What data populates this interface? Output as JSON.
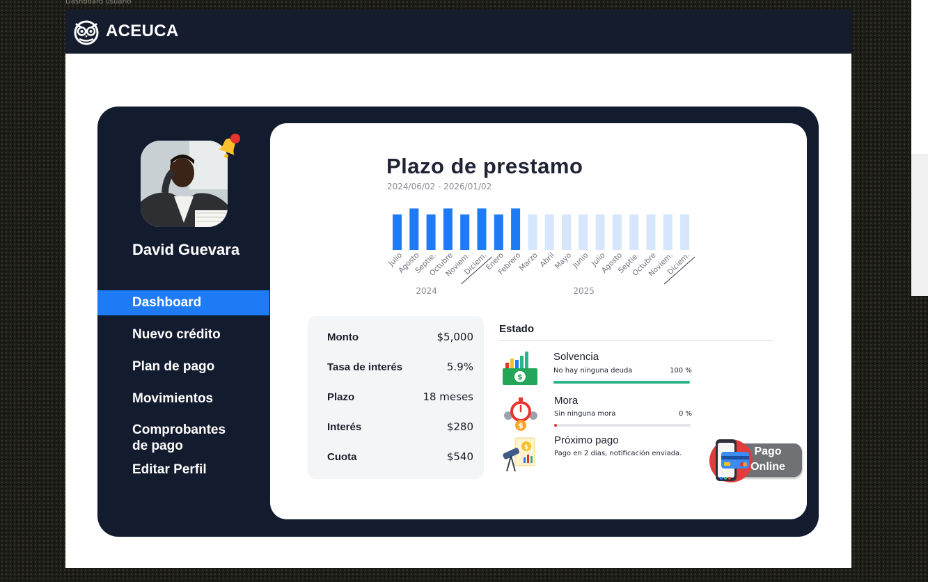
{
  "frame": {
    "label": "Dashboard usuario"
  },
  "brand": {
    "name": "ACEUCA",
    "icon": "owl-logo-icon"
  },
  "user": {
    "name": "David Guevara",
    "notification_icon": "bell-icon"
  },
  "nav": {
    "items": [
      {
        "label": "Dashboard",
        "active": true
      },
      {
        "label": "Nuevo crédito",
        "active": false
      },
      {
        "label": "Plan de pago",
        "active": false
      },
      {
        "label": "Movimientos",
        "active": false
      },
      {
        "label": "Comprobantes de pago",
        "active": false
      },
      {
        "label": "Editar Perfil",
        "active": false
      }
    ]
  },
  "chart_data": {
    "type": "bar",
    "title": "Plazo de prestamo",
    "subtitle": "2024/06/02 - 2026/01/02",
    "categories": [
      "Julio",
      "Agosto",
      "Septie.",
      "Octubre",
      "Noviem.",
      "Diciem.",
      "Enero",
      "Febrero",
      "Marzo",
      "Abril",
      "Mayo",
      "Junio",
      "Julio",
      "Agosto",
      "Septie.",
      "Octubre",
      "Noviem.",
      "Diciem."
    ],
    "values": [
      47,
      55,
      47,
      55,
      47,
      55,
      47,
      55,
      47,
      47,
      47,
      47,
      47,
      47,
      47,
      47,
      47,
      47
    ],
    "paid": [
      true,
      true,
      true,
      true,
      true,
      true,
      true,
      true,
      false,
      false,
      false,
      false,
      false,
      false,
      false,
      false,
      false,
      false
    ],
    "groups": [
      {
        "label": "2024"
      },
      {
        "label": "2025"
      }
    ],
    "colors": {
      "paid": "#1e7bf5",
      "pending": "#d6e6fc"
    },
    "grid": false
  },
  "loan": {
    "rows": [
      {
        "label": "Monto",
        "value": "$5,000"
      },
      {
        "label": "Tasa de interés",
        "value": "5.9%"
      },
      {
        "label": "Plazo",
        "value": "18 meses"
      },
      {
        "label": "Interés",
        "value": "$280"
      },
      {
        "label": "Cuota",
        "value": "$540"
      }
    ]
  },
  "estado": {
    "title": "Estado",
    "items": [
      {
        "title": "Solvencia",
        "desc": "No hay ninguna deuda",
        "pct": "100 %",
        "progress": 1.0,
        "color": "#2bb38a",
        "icon": "money-growth-icon"
      },
      {
        "title": "Mora",
        "desc": "Sin ninguna mora",
        "pct": "0 %",
        "progress": 0.0,
        "color": "#e8322b",
        "icon": "stopwatch-money-icon"
      },
      {
        "title": "Próximo pago",
        "desc": "Pago en 2 días, notificación enviada.",
        "icon": "telescope-chart-icon"
      }
    ]
  },
  "pago_online": {
    "line1": "Pago",
    "line2": "Online",
    "icon": "phone-card-icon"
  }
}
